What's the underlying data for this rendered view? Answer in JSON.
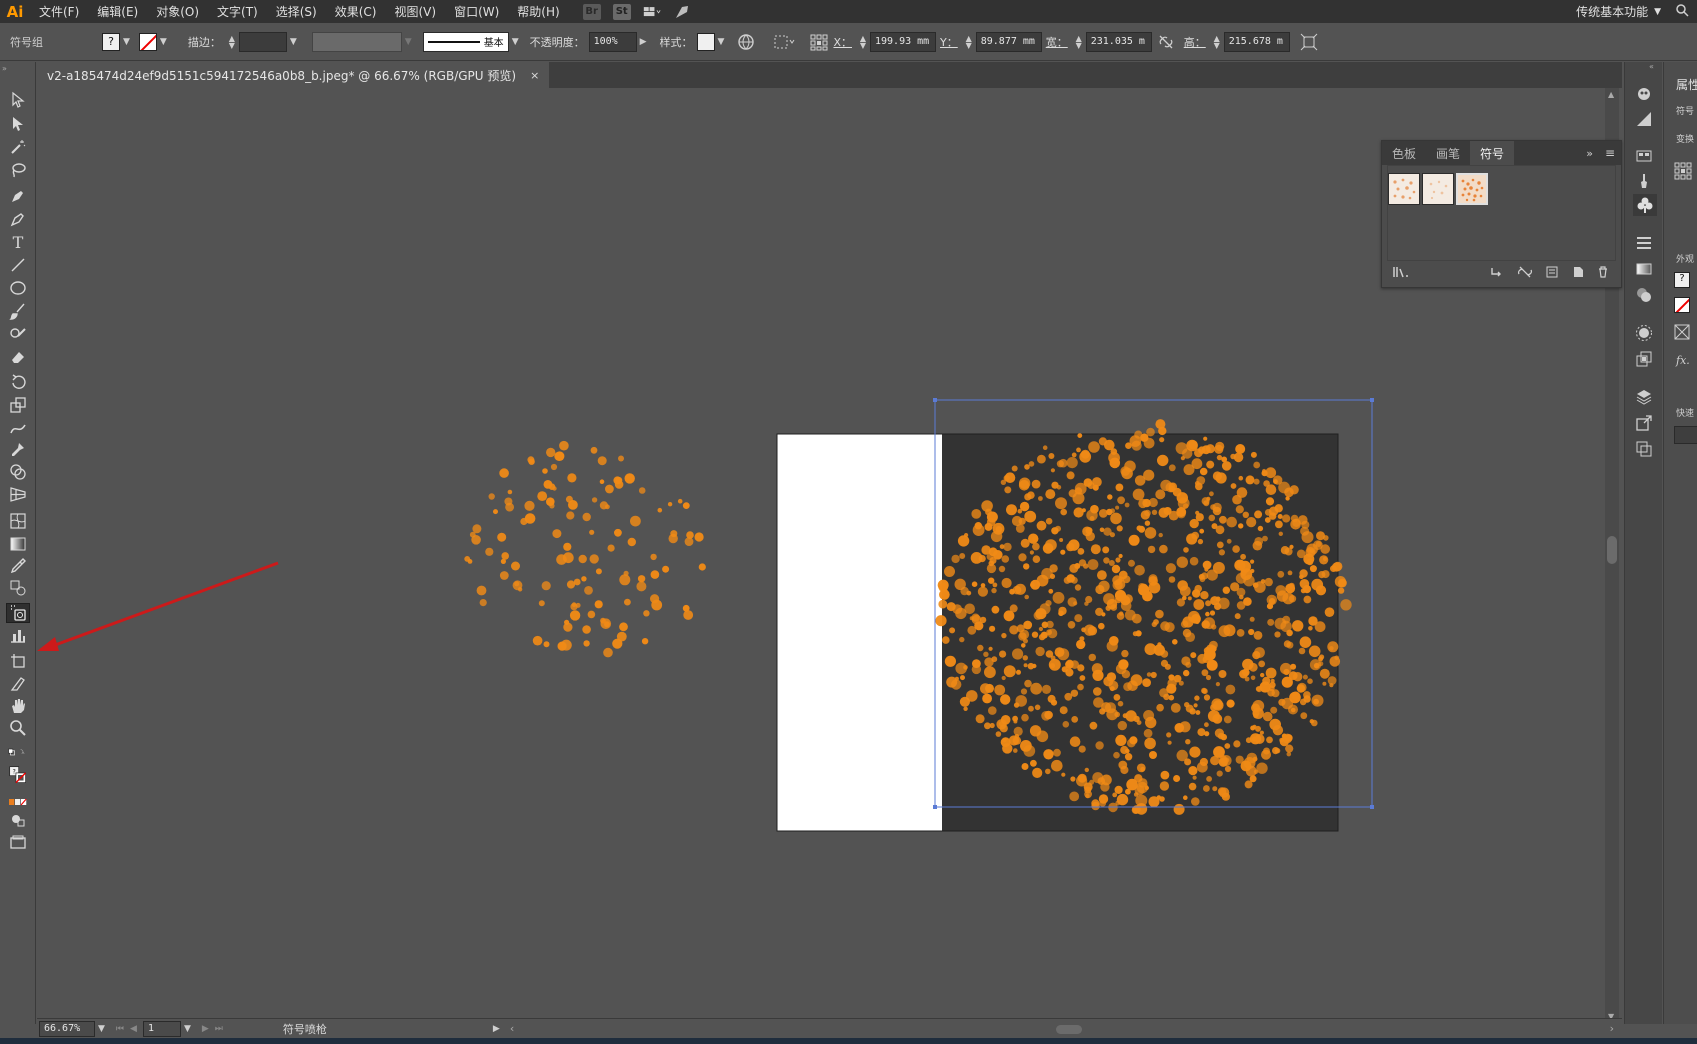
{
  "app": {
    "logo": "Ai",
    "workspace": "传统基本功能"
  },
  "menu": [
    "文件(F)",
    "编辑(E)",
    "对象(O)",
    "文字(T)",
    "选择(S)",
    "效果(C)",
    "视图(V)",
    "窗口(W)",
    "帮助(H)"
  ],
  "menubar_icons": {
    "br": "Br",
    "st": "St"
  },
  "control": {
    "object_type": "符号组",
    "stroke_label": "描边：",
    "stroke_style": "基本",
    "opacity_label": "不透明度：",
    "opacity_value": "100%",
    "style_label": "样式：",
    "x_label": "X：",
    "x_value": "199.93 mm",
    "y_label": "Y：",
    "y_value": "89.877 mm",
    "w_label": "宽：",
    "w_value": "231.035 m",
    "h_label": "高：",
    "h_value": "215.678 m"
  },
  "document_tab": {
    "title": "v2-a185474d24ef9d5151c594172546a0b8_b.jpeg* @ 66.67% (RGB/GPU 预览)",
    "close": "×"
  },
  "symbol_panel": {
    "tabs": [
      "色板",
      "画笔",
      "符号"
    ],
    "active_tab": "符号",
    "swatch_count": 3,
    "selected_swatch": 3
  },
  "right_panel": {
    "properties": "属性",
    "symbol_short": "符号",
    "transform": "变换",
    "appearance": "外观",
    "quick": "快速"
  },
  "status": {
    "zoom": "66.67%",
    "page": "1",
    "tool_name": "符号喷枪"
  },
  "colors": {
    "accent_orange": "#f08a16",
    "selection_blue": "#5b7bd5",
    "arrow_red": "#cc1a1a",
    "artboard_dark": "#333333",
    "artboard_white": "#ffffff"
  }
}
